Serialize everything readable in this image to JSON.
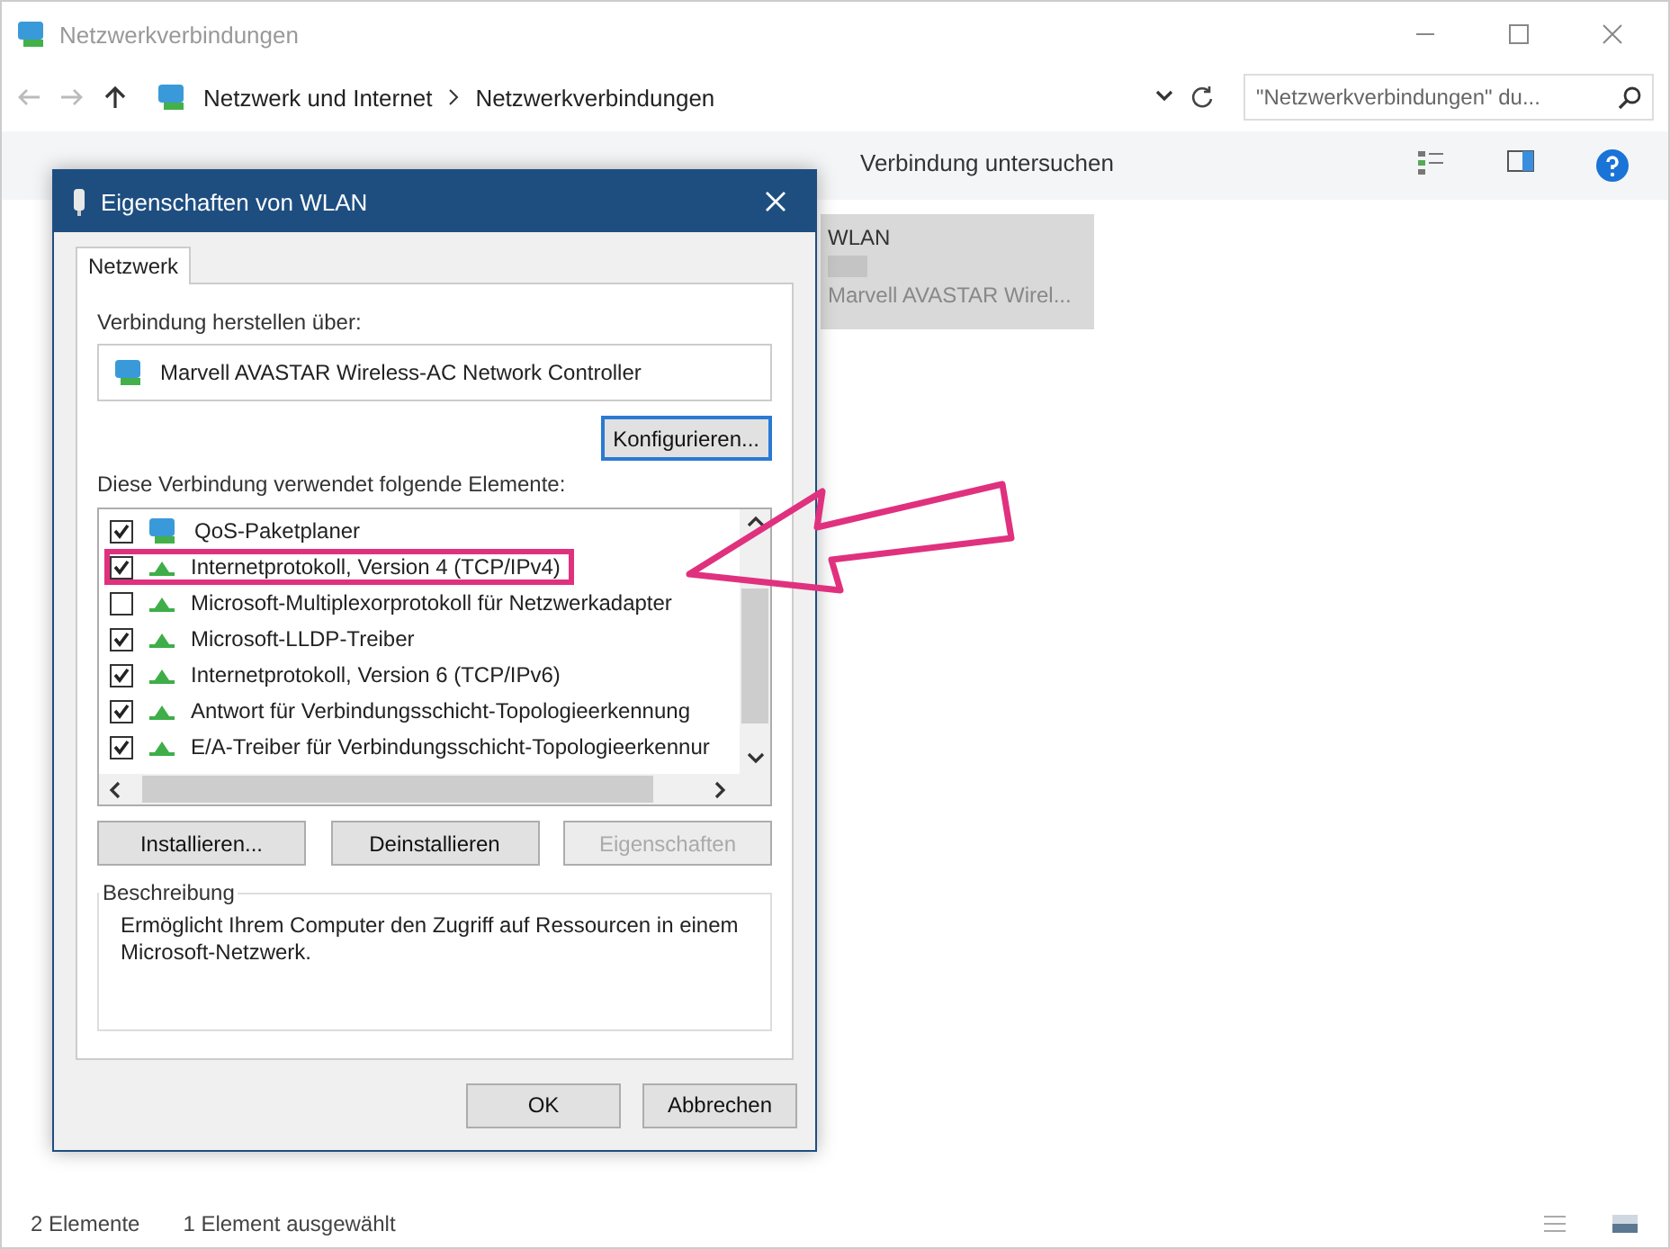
{
  "window": {
    "title": "Netzwerkverbindungen"
  },
  "address_bar": {
    "path": [
      "Netzwerk und Internet",
      "Netzwerkverbindungen"
    ],
    "search_placeholder": "\"Netzwerkverbindungen\" du..."
  },
  "toolbar": {
    "items": [
      "Verbindung untersuchen"
    ]
  },
  "connections": [
    {
      "name": "WLAN",
      "device": "Marvell AVASTAR Wirel...",
      "selected": true
    }
  ],
  "status_bar": {
    "count": "2 Elemente",
    "selection": "1 Element ausgewählt"
  },
  "dialog": {
    "title": "Eigenschaften von WLAN",
    "tabs": [
      {
        "label": "Netzwerk",
        "selected": true
      }
    ],
    "connect_label": "Verbindung herstellen über:",
    "adapter": "Marvell AVASTAR Wireless-AC Network Controller",
    "configure_button": "Konfigurieren...",
    "items_label": "Diese Verbindung verwendet folgende Elemente:",
    "items": [
      {
        "label": "QoS-Paketplaner",
        "kind": "service",
        "checked": true,
        "highlighted": false
      },
      {
        "label": "Internetprotokoll, Version 4 (TCP/IPv4)",
        "kind": "protocol",
        "checked": true,
        "highlighted": true
      },
      {
        "label": "Microsoft-Multiplexorprotokoll für Netzwerkadapter",
        "kind": "protocol",
        "checked": false,
        "highlighted": false
      },
      {
        "label": "Microsoft-LLDP-Treiber",
        "kind": "protocol",
        "checked": true,
        "highlighted": false
      },
      {
        "label": "Internetprotokoll, Version 6 (TCP/IPv6)",
        "kind": "protocol",
        "checked": true,
        "highlighted": false
      },
      {
        "label": "Antwort für Verbindungsschicht-Topologieerkennung",
        "kind": "protocol",
        "checked": true,
        "highlighted": false
      },
      {
        "label": "E/A-Treiber für Verbindungsschicht-Topologieerkennur",
        "kind": "protocol",
        "checked": true,
        "highlighted": false
      }
    ],
    "actions": [
      {
        "label": "Installieren...",
        "disabled": false
      },
      {
        "label": "Deinstallieren",
        "disabled": false
      },
      {
        "label": "Eigenschaften",
        "disabled": true
      }
    ],
    "description_title": "Beschreibung",
    "description": "Ermöglicht Ihrem Computer den Zugriff auf Ressourcen in einem Microsoft-Netzwerk.",
    "buttons": [
      "OK",
      "Abbrechen"
    ]
  }
}
